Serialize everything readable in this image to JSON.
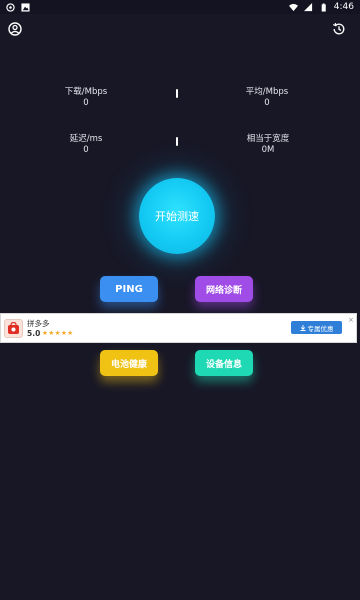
{
  "status_bar": {
    "time": "4:46",
    "left_icons": [
      "notification-icon",
      "image-icon"
    ],
    "right_icons": [
      "wifi-icon",
      "signal-icon",
      "battery-icon"
    ]
  },
  "topbar": {
    "left_icon": "profile-icon",
    "right_icon": "history-icon"
  },
  "metrics": {
    "download": {
      "label": "下载/Mbps",
      "value": "0"
    },
    "average": {
      "label": "平均/Mbps",
      "value": "0"
    },
    "latency": {
      "label": "延迟/ms",
      "value": "0"
    },
    "bandwidth": {
      "label": "相当于宽度",
      "value": "0M"
    }
  },
  "start_button": {
    "label": "开始测速"
  },
  "actions": {
    "ping": "PING",
    "network_diagnosis": "网络诊断",
    "battery_health": "电池健康",
    "device_info": "设备信息"
  },
  "ad": {
    "app_name": "拼多多",
    "rating": "5.0",
    "stars": "★★★★★",
    "cta": "专属优惠",
    "close": "×"
  },
  "colors": {
    "background": "#181726",
    "start": "#12c8f2",
    "ping": "#3a8ff0",
    "diagnosis": "#a04ce6",
    "battery": "#f0c214",
    "device": "#1fd9b4"
  }
}
